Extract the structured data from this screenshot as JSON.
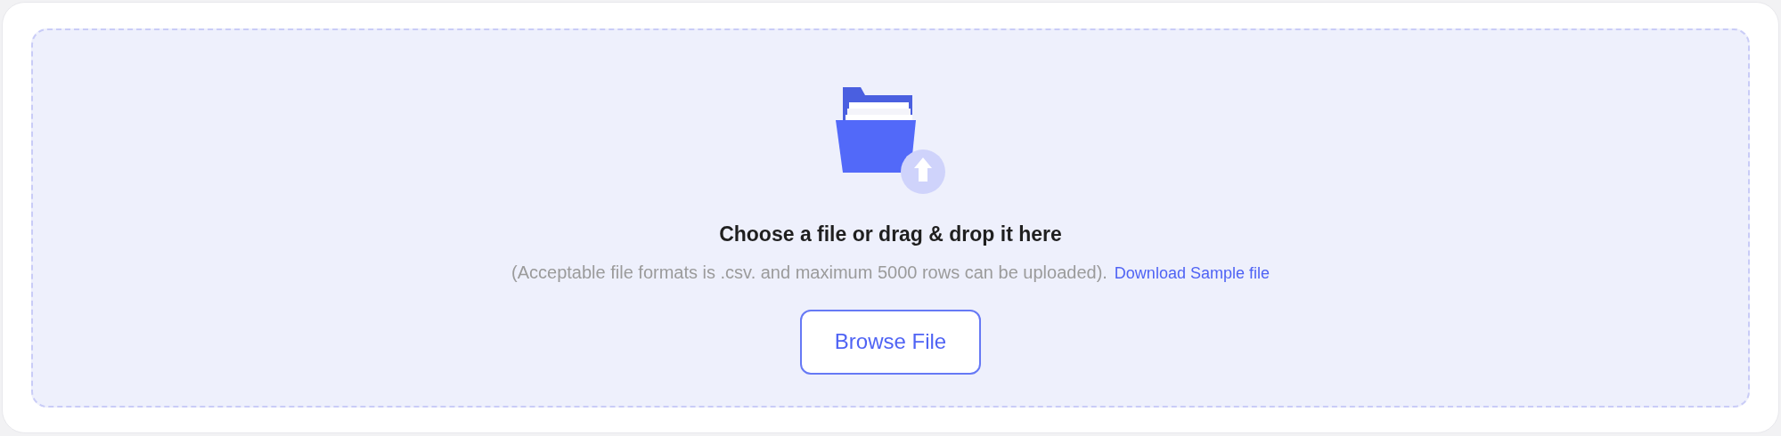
{
  "upload": {
    "title": "Choose a file or drag & drop it here",
    "note": "(Acceptable file formats is .csv. and maximum 5000 rows can be uploaded).",
    "sample_link": "Download Sample file",
    "button": "Browse File"
  }
}
